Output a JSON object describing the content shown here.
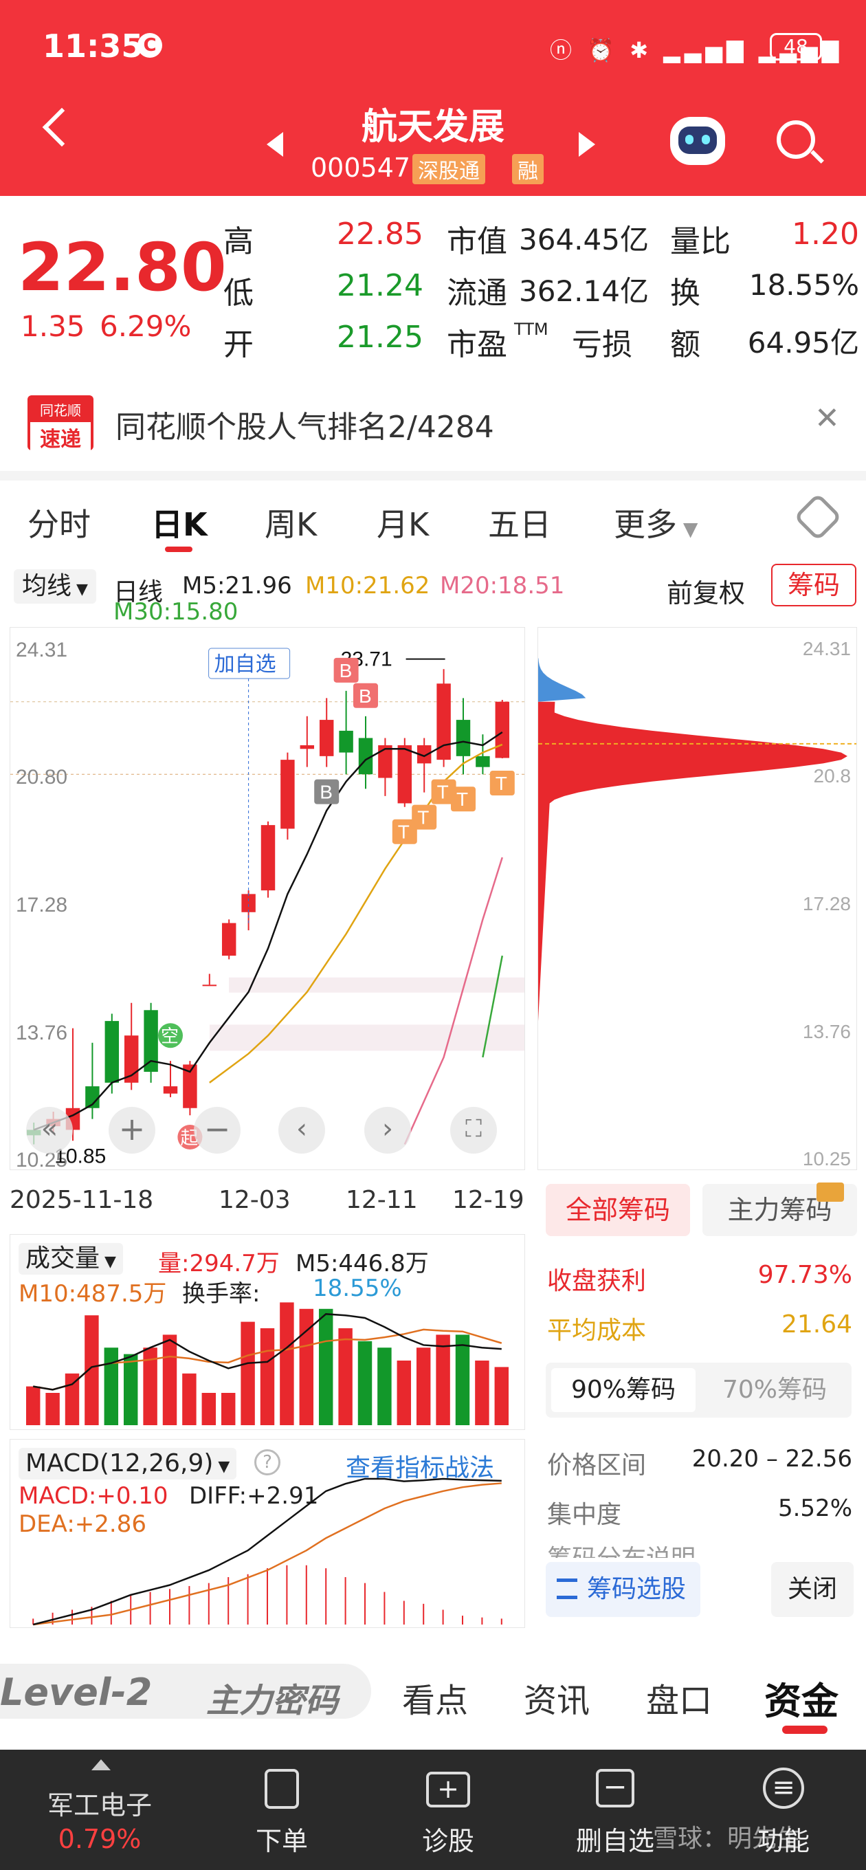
{
  "status_bar": {
    "time": "11:35",
    "battery": "48"
  },
  "header": {
    "stock_name": "航天发展",
    "stock_code": "000547",
    "tag_connect": "深股通",
    "tag_margin": "融"
  },
  "quote": {
    "price": "22.80",
    "change": "1.35",
    "change_pct": "6.29%",
    "high_label": "高",
    "high": "22.85",
    "low_label": "低",
    "low": "21.24",
    "open_label": "开",
    "open": "21.25",
    "mcap_label": "市值",
    "mcap": "364.45亿",
    "float_label": "流通",
    "float": "362.14亿",
    "pe_label": "市盈",
    "pe_sup": "TTM",
    "pe": "亏损",
    "vol_ratio_label": "量比",
    "vol_ratio": "1.20",
    "turnover_label": "换",
    "turnover": "18.55%",
    "amount_label": "额",
    "amount": "64.95亿"
  },
  "popularity": {
    "logo_top": "同花顺",
    "logo_bottom": "速递",
    "text": "同花顺个股人气排名2/4284"
  },
  "tabs": [
    "分时",
    "日K",
    "周K",
    "月K",
    "五日",
    "更多"
  ],
  "legend": {
    "ma_select": "均线",
    "period": "日线",
    "m5": "M5:21.96",
    "m10": "M10:21.62",
    "m20": "M20:18.51",
    "m30": "M30:15.80",
    "adjust": "前复权",
    "chip_btn": "筹码"
  },
  "kline": {
    "y_ticks": [
      "24.31",
      "20.80",
      "17.28",
      "13.76",
      "10.25"
    ],
    "x_ticks": [
      "2025-11-18",
      "12-03",
      "12-11",
      "12-19"
    ],
    "high_marker": "23.71",
    "low_marker": "10.85",
    "add_watch": "加自选",
    "empty_tag": "空",
    "start_tag": "起",
    "markers": [
      "B",
      "B",
      "B",
      "T",
      "T",
      "T",
      "T",
      "T"
    ]
  },
  "chip_axis": [
    "24.31",
    "20.8",
    "17.28",
    "13.76",
    "10.25"
  ],
  "chip_panel": {
    "tab_all": "全部筹码",
    "tab_main": "主力筹码",
    "profit_label": "收盘获利",
    "profit": "97.73%",
    "avg_label": "平均成本",
    "avg": "21.64",
    "pct90": "90%筹码",
    "pct70": "70%筹码",
    "range_label": "价格区间",
    "range": "20.20 – 22.56",
    "conc_label": "集中度",
    "conc": "5.52%",
    "note_label": "筹码分布说明",
    "select_btn": "筹码选股",
    "close_btn": "关闭"
  },
  "volume": {
    "select": "成交量",
    "vol": "量:294.7万",
    "m5": "M5:446.8万",
    "m10": "M10:487.5万",
    "turnover_label": "换手率:",
    "turnover": "18.55%"
  },
  "macd": {
    "select": "MACD(12,26,9)",
    "link": "查看指标战法",
    "macd": "MACD:+0.10",
    "diff": "DIFF:+2.91",
    "dea": "DEA:+2.86"
  },
  "bottom_tabs": [
    "Level-2",
    "主力密码",
    "看点",
    "资讯",
    "盘口",
    "资金"
  ],
  "bottom_nav": {
    "sector": "军工电子",
    "sector_pct": "0.79%",
    "order": "下单",
    "diagnose": "诊股",
    "remove": "删自选",
    "func": "功能",
    "watermark": "雪球：明先生"
  },
  "chart_data": {
    "type": "candlestick",
    "x_ticks": [
      "2025-11-18",
      "12-03",
      "12-11",
      "12-19"
    ],
    "ylim": [
      10.25,
      24.31
    ],
    "candles": [
      {
        "o": 11.0,
        "c": 10.85,
        "h": 11.2,
        "l": 10.6
      },
      {
        "o": 11.1,
        "c": 11.3,
        "h": 11.5,
        "l": 10.9
      },
      {
        "o": 11.0,
        "c": 11.6,
        "h": 13.8,
        "l": 10.7
      },
      {
        "o": 12.2,
        "c": 11.6,
        "h": 13.4,
        "l": 11.3
      },
      {
        "o": 14.0,
        "c": 12.3,
        "h": 14.2,
        "l": 12.0
      },
      {
        "o": 12.3,
        "c": 13.6,
        "h": 14.5,
        "l": 12.1
      },
      {
        "o": 14.3,
        "c": 12.6,
        "h": 14.5,
        "l": 12.3
      },
      {
        "o": 12.0,
        "c": 12.2,
        "h": 12.9,
        "l": 11.9
      },
      {
        "o": 11.6,
        "c": 12.8,
        "h": 12.9,
        "l": 11.4
      },
      {
        "o": 15.0,
        "c": 15.0,
        "h": 15.3,
        "l": 15.0
      },
      {
        "o": 15.8,
        "c": 16.7,
        "h": 16.8,
        "l": 15.7
      },
      {
        "o": 17.0,
        "c": 17.5,
        "h": 17.6,
        "l": 16.5
      },
      {
        "o": 17.6,
        "c": 19.4,
        "h": 19.5,
        "l": 17.4
      },
      {
        "o": 19.3,
        "c": 21.2,
        "h": 21.4,
        "l": 19.0
      },
      {
        "o": 21.5,
        "c": 21.6,
        "h": 22.4,
        "l": 21.0
      },
      {
        "o": 21.3,
        "c": 22.3,
        "h": 22.9,
        "l": 21.0
      },
      {
        "o": 22.0,
        "c": 21.4,
        "h": 23.1,
        "l": 20.8
      },
      {
        "o": 21.8,
        "c": 20.8,
        "h": 22.4,
        "l": 20.4
      },
      {
        "o": 20.7,
        "c": 21.6,
        "h": 21.8,
        "l": 20.2
      },
      {
        "o": 20.0,
        "c": 21.6,
        "h": 21.8,
        "l": 19.9
      },
      {
        "o": 21.1,
        "c": 21.6,
        "h": 21.8,
        "l": 20.3
      },
      {
        "o": 21.2,
        "c": 23.3,
        "h": 23.7,
        "l": 21.0
      },
      {
        "o": 22.3,
        "c": 21.3,
        "h": 22.9,
        "l": 20.8
      },
      {
        "o": 21.3,
        "c": 21.0,
        "h": 21.9,
        "l": 20.8
      },
      {
        "o": 21.25,
        "c": 22.8,
        "h": 22.85,
        "l": 21.24
      }
    ],
    "ma5": [
      11.0,
      11.2,
      11.4,
      11.7,
      12.3,
      12.5,
      12.9,
      12.8,
      12.6,
      13.4,
      14.1,
      14.8,
      16.0,
      17.5,
      18.6,
      19.8,
      20.6,
      21.2,
      21.5,
      21.5,
      21.3,
      21.6,
      21.7,
      21.6,
      21.96
    ],
    "ma10": [
      null,
      null,
      null,
      null,
      null,
      null,
      null,
      null,
      null,
      12.3,
      12.7,
      13.1,
      13.6,
      14.2,
      14.8,
      15.6,
      16.4,
      17.3,
      18.2,
      19.0,
      19.8,
      20.6,
      21.1,
      21.4,
      21.62
    ],
    "ma20": [
      null,
      null,
      null,
      null,
      null,
      null,
      null,
      null,
      null,
      null,
      null,
      null,
      null,
      null,
      null,
      null,
      null,
      null,
      null,
      10.6,
      11.8,
      13.0,
      14.9,
      16.8,
      18.51
    ],
    "ma30": [
      null,
      null,
      null,
      null,
      null,
      null,
      null,
      null,
      null,
      null,
      null,
      null,
      null,
      null,
      null,
      null,
      null,
      null,
      null,
      null,
      null,
      null,
      null,
      13.0,
      15.8
    ],
    "volume": [
      30,
      25,
      40,
      85,
      60,
      55,
      60,
      70,
      40,
      25,
      25,
      80,
      75,
      95,
      90,
      90,
      75,
      65,
      60,
      50,
      60,
      70,
      70,
      50,
      45
    ],
    "volume_dir": [
      "u",
      "u",
      "u",
      "u",
      "d",
      "d",
      "u",
      "u",
      "u",
      "u",
      "u",
      "u",
      "u",
      "u",
      "u",
      "d",
      "u",
      "d",
      "d",
      "u",
      "u",
      "u",
      "d",
      "u",
      "u"
    ],
    "macd_hist": [
      0.1,
      0.2,
      0.25,
      0.3,
      0.4,
      0.5,
      0.55,
      0.6,
      0.65,
      0.7,
      0.8,
      0.85,
      0.95,
      1.0,
      1.0,
      0.95,
      0.8,
      0.7,
      0.55,
      0.4,
      0.35,
      0.25,
      0.15,
      0.12,
      0.1
    ],
    "diff": [
      0.0,
      0.1,
      0.2,
      0.3,
      0.45,
      0.6,
      0.7,
      0.8,
      0.95,
      1.1,
      1.3,
      1.5,
      1.8,
      2.1,
      2.4,
      2.7,
      2.85,
      2.95,
      2.95,
      2.9,
      2.92,
      2.95,
      2.93,
      2.92,
      2.91
    ],
    "dea": [
      0.0,
      0.05,
      0.1,
      0.15,
      0.2,
      0.3,
      0.4,
      0.5,
      0.6,
      0.7,
      0.8,
      0.95,
      1.1,
      1.3,
      1.5,
      1.75,
      1.95,
      2.15,
      2.35,
      2.5,
      2.6,
      2.7,
      2.78,
      2.83,
      2.86
    ]
  }
}
